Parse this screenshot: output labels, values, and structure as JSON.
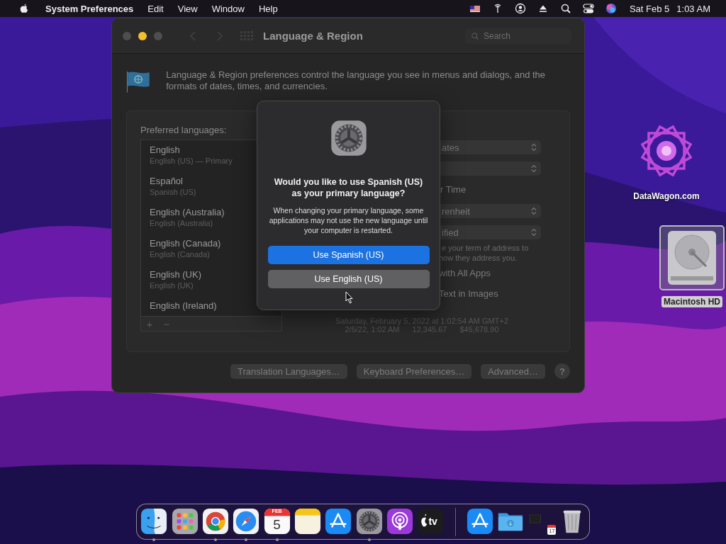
{
  "menu_bar": {
    "app_name": "System Preferences",
    "menus": [
      "Edit",
      "View",
      "Window",
      "Help"
    ],
    "date": "Sat Feb 5",
    "time": "1:03 AM"
  },
  "window": {
    "title": "Language & Region",
    "search": {
      "placeholder": "Search"
    },
    "description": "Language & Region preferences control the language you see in menus and dialogs, and the formats of dates, times, and currencies.",
    "preferred_label": "Preferred languages:",
    "languages": [
      {
        "name": "English",
        "detail": "English (US) — Primary"
      },
      {
        "name": "Español",
        "detail": "Spanish (US)"
      },
      {
        "name": "English (Australia)",
        "detail": "English (Australia)"
      },
      {
        "name": "English (Canada)",
        "detail": "English (Canada)"
      },
      {
        "name": "English (UK)",
        "detail": "English (UK)"
      },
      {
        "name": "English (Ireland)"
      }
    ],
    "list_buttons": [
      "+",
      "−"
    ],
    "right_column": [
      {
        "kind": "popup",
        "text": "ates"
      },
      {
        "kind": "popup"
      },
      {
        "kind": "label",
        "text": "r Time"
      },
      {
        "kind": "popup",
        "text": "renheit"
      },
      {
        "kind": "popup",
        "text": "ified"
      },
      {
        "kind": "note",
        "text": "e your term of address to"
      },
      {
        "kind": "note",
        "text": "how they address you."
      },
      {
        "kind": "option",
        "text": "with All Apps"
      },
      {
        "kind": "option",
        "text": "Text in Images"
      }
    ],
    "sample_date": "Saturday, February 5, 2022 at 1:02:54 AM GMT+2",
    "sample_formats": [
      "2/5/22, 1:02 AM",
      "12,345.67",
      "$45,678.90"
    ],
    "buttons": [
      "Translation Languages…",
      "Keyboard Preferences…",
      "Advanced…"
    ],
    "help": "?"
  },
  "dialog": {
    "title": "Would you like to use Spanish (US) as your primary language?",
    "message": "When changing your primary language, some applications may not use the new language until your computer is restarted.",
    "buttons": [
      {
        "label": "Use Spanish (US)",
        "default": true
      },
      {
        "label": "Use English (US)",
        "default": false
      }
    ]
  },
  "desktop_icons": [
    {
      "kind": "logo",
      "label": "DataWagon.com",
      "selected": false
    },
    {
      "kind": "disk",
      "label": "Macintosh HD",
      "selected": true
    }
  ],
  "dock": [
    {
      "kind": "finder",
      "running": true
    },
    {
      "kind": "launchpad",
      "running": false
    },
    {
      "kind": "chrome",
      "running": true
    },
    {
      "kind": "safari",
      "running": true
    },
    {
      "kind": "calendar",
      "running": true,
      "month": "FEB",
      "day": "5"
    },
    {
      "kind": "notes",
      "running": false
    },
    {
      "kind": "appstore",
      "running": false
    },
    {
      "kind": "settings",
      "running": true
    },
    {
      "kind": "podcasts",
      "running": false
    },
    {
      "kind": "tv",
      "running": false,
      "text": "tv"
    },
    {
      "kind": "separator"
    },
    {
      "kind": "appstore",
      "running": false
    },
    {
      "kind": "folder",
      "running": false
    },
    {
      "kind": "screenshot",
      "running": false,
      "day": "17"
    },
    {
      "kind": "trash",
      "running": false
    }
  ]
}
